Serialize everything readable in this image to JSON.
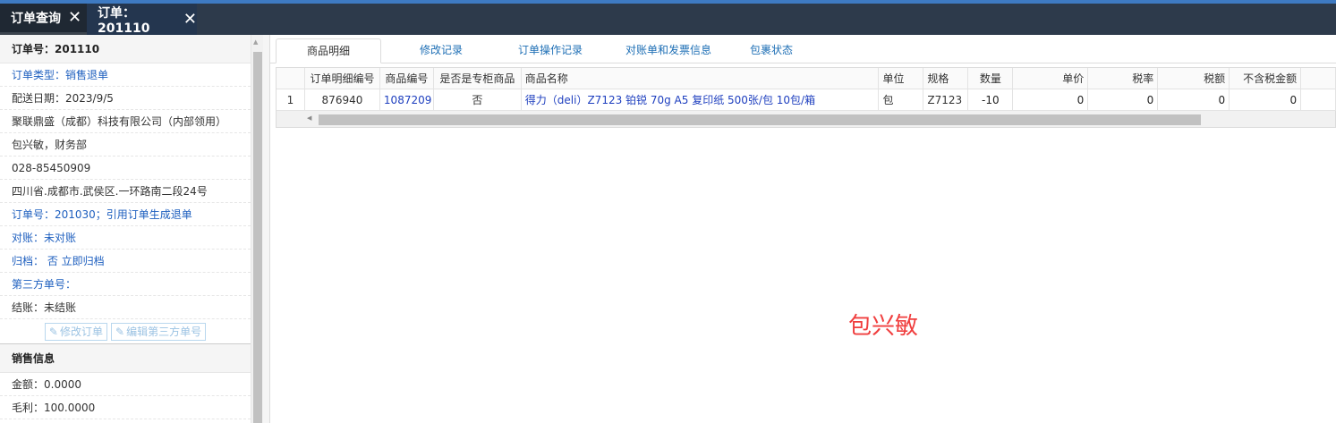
{
  "tabs": [
    {
      "label": "订单查询"
    },
    {
      "label": "订单：201110"
    }
  ],
  "info": {
    "title": "订单号：201110",
    "order_type": "订单类型：销售退单",
    "delivery_date": "配送日期：2023/9/5",
    "company": "聚联鼎盛（成都）科技有限公司（内部领用）",
    "contact": "包兴敏，财务部",
    "phone": "028-85450909",
    "address": "四川省.成都市.武侯区.一环路南二段24号",
    "ref_order": "订单号：201030；引用订单生成退单",
    "reconcile": "对账：未对账",
    "archive": "归档： 否 立即归档",
    "third_party": "第三方单号：",
    "settle": "结账：未结账",
    "btn_modify": "修改订单",
    "btn_edit_third": "编辑第三方单号"
  },
  "sales": {
    "title": "销售信息",
    "amount": "金额：0.0000",
    "gross": "毛利：100.0000"
  },
  "subtabs": [
    "商品明细",
    "修改记录",
    "订单操作记录",
    "对账单和发票信息",
    "包裹状态"
  ],
  "grid": {
    "headers": [
      "订单明细编号",
      "商品编号",
      "是否是专柜商品",
      "商品名称",
      "单位",
      "规格",
      "数量",
      "单价",
      "税率",
      "税额",
      "不含税金额"
    ],
    "rows": [
      {
        "index": "1",
        "detail_id": "876940",
        "product_id": "1087209",
        "is_counter": "否",
        "name": "得力（deli）Z7123 铂锐 70g A5 复印纸 500张/包 10包/箱",
        "unit": "包",
        "spec": "Z7123",
        "qty": "-10",
        "price": "0",
        "tax_rate": "0",
        "tax": "0",
        "net": "0"
      }
    ]
  },
  "watermark": "包兴敏",
  "colors": {
    "accent": "#3e7ac2",
    "tabbar": "#2d3a4b",
    "link": "#1e5fbf",
    "watermark": "#f03e3e"
  }
}
